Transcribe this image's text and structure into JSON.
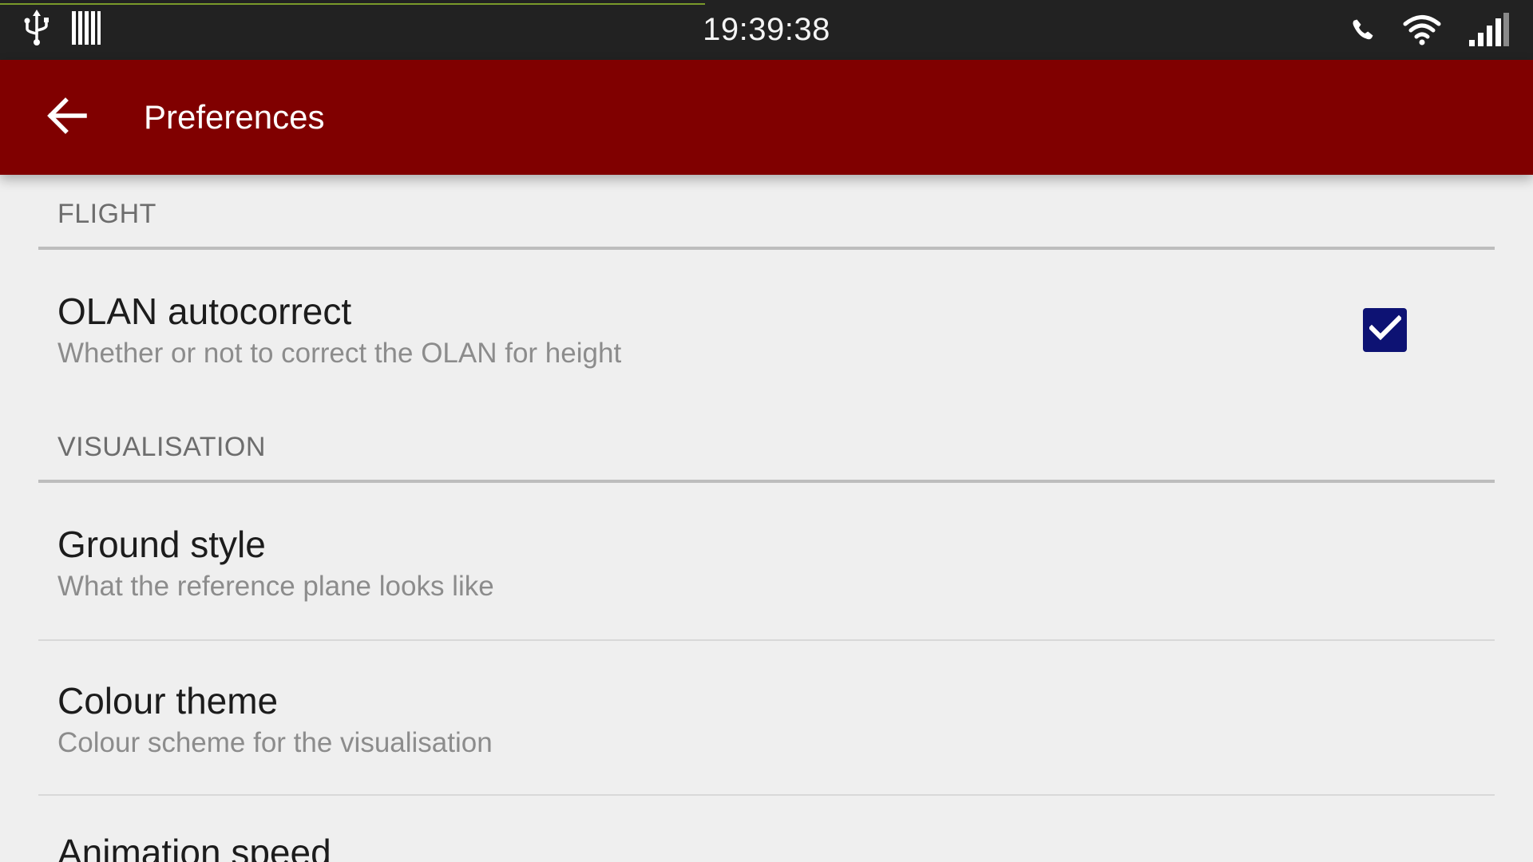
{
  "status_bar": {
    "time": "19:39:38",
    "left_icons": [
      "usb-icon",
      "barcode-icon"
    ],
    "right_icons": [
      "phone-icon",
      "wifi-icon",
      "signal-icon"
    ],
    "progress_fraction": 0.46
  },
  "app_bar": {
    "title": "Preferences",
    "back_icon": "arrow-back-icon",
    "color": "#800000"
  },
  "preferences": {
    "flight": {
      "header": "FLIGHT",
      "olan_autocorrect": {
        "title": "OLAN autocorrect",
        "summary": "Whether or not to correct the OLAN for height",
        "checked": true
      }
    },
    "visualisation": {
      "header": "VISUALISATION",
      "ground_style": {
        "title": "Ground style",
        "summary": "What the reference plane looks like"
      },
      "colour_theme": {
        "title": "Colour theme",
        "summary": "Colour scheme for the visualisation"
      },
      "animation_speed": {
        "title": "Animation speed"
      }
    }
  },
  "colors": {
    "accent": "#0d1273",
    "status_bar": "#222222",
    "background": "#efefef"
  }
}
